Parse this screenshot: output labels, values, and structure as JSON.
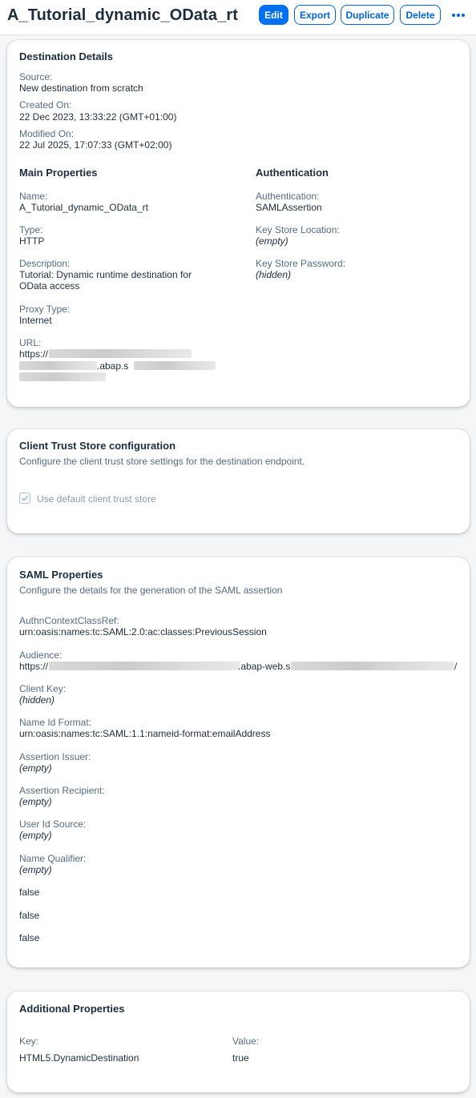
{
  "header": {
    "title": "A_Tutorial_dynamic_OData_rt",
    "edit": "Edit",
    "export": "Export",
    "duplicate": "Duplicate",
    "delete": "Delete"
  },
  "destination_details": {
    "heading": "Destination Details",
    "source_label": "Source:",
    "source_value": "New destination from scratch",
    "created_label": "Created On:",
    "created_value": "22 Dec 2023, 13:33:22 (GMT+01:00)",
    "modified_label": "Modified On:",
    "modified_value": "22 Jul 2025, 17:07:33 (GMT+02:00)",
    "main_heading": "Main Properties",
    "name_label": "Name:",
    "name_value": "A_Tutorial_dynamic_OData_rt",
    "type_label": "Type:",
    "type_value": "HTTP",
    "description_label": "Description:",
    "description_line1": "Tutorial: Dynamic runtime destination for",
    "description_line2": "OData access",
    "proxy_label": "Proxy Type:",
    "proxy_value": "Internet",
    "url_label": "URL:",
    "url_prefix": "https://",
    "url_fragment": ".abap.s",
    "auth_heading": "Authentication",
    "auth_label": "Authentication:",
    "auth_value": "SAMLAssertion",
    "keystore_loc_label": "Key Store Location:",
    "keystore_loc_value": "(empty)",
    "keystore_pw_label": "Key Store Password:",
    "keystore_pw_value": "(hidden)"
  },
  "client_trust": {
    "heading": "Client Trust Store configuration",
    "subtitle": "Configure the client trust store settings for the destination endpoint.",
    "checkbox_label": "Use default client trust store",
    "checkbox_checked": true
  },
  "saml": {
    "heading": "SAML Properties",
    "subtitle": "Configure the details for the generation of the SAML assertion",
    "authn_label": "AuthnContextClassRef:",
    "authn_value": "urn:oasis:names:tc:SAML:2.0:ac:classes:PreviousSession",
    "audience_label": "Audience:",
    "audience_prefix": "https://",
    "audience_mid": ".abap-web.s",
    "audience_suffix": "/",
    "client_key_label": "Client Key:",
    "client_key_value": "(hidden)",
    "nameid_label": "Name Id Format:",
    "nameid_value": "urn:oasis:names:tc:SAML:1.1:nameid-format:emailAddress",
    "issuer_label": "Assertion Issuer:",
    "issuer_value": "(empty)",
    "recipient_label": "Assertion Recipient:",
    "recipient_value": "(empty)",
    "userid_label": "User Id Source:",
    "userid_value": "(empty)",
    "qualifier_label": "Name Qualifier:",
    "qualifier_value": "(empty)",
    "flag1": "false",
    "flag2": "false",
    "flag3": "false"
  },
  "additional": {
    "heading": "Additional Properties",
    "key_label": "Key:",
    "value_label": "Value:",
    "key_value": "HTML5.DynamicDestination",
    "value_value": "true"
  },
  "colors": {
    "brand": "#0070f2",
    "link": "#0064d9",
    "text": "#1d2d3e",
    "label": "#556b82",
    "background": "#f5f6f7"
  }
}
